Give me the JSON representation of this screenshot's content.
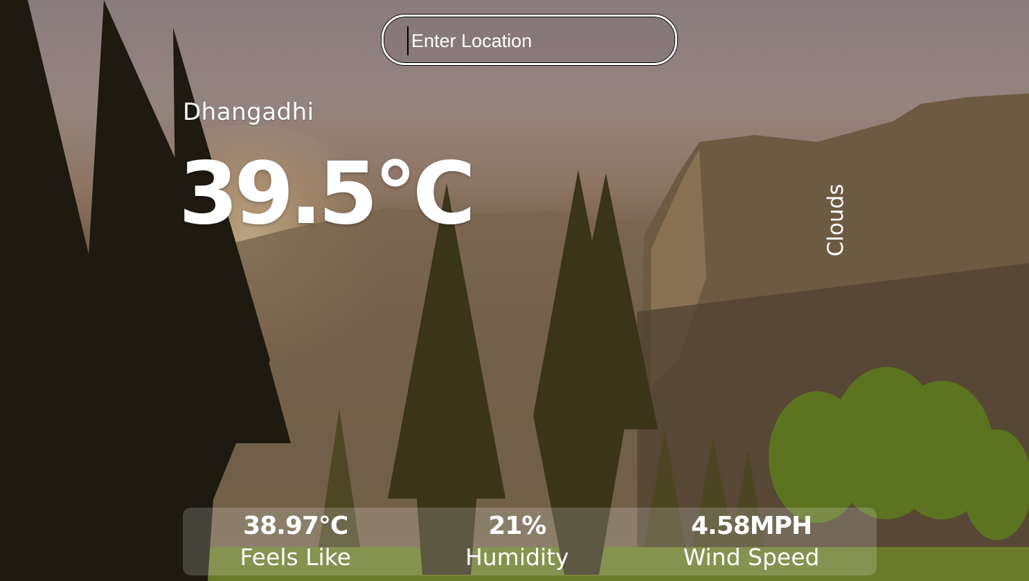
{
  "search": {
    "placeholder": "Enter Location"
  },
  "weather": {
    "location": "Dhangadhi",
    "temperature": "39.5°C",
    "condition": "Clouds"
  },
  "stats": [
    {
      "value": "38.97°C",
      "label": "Feels Like"
    },
    {
      "value": "21%",
      "label": "Humidity"
    },
    {
      "value": "4.58MPH",
      "label": "Wind Speed"
    }
  ],
  "background": {
    "description_icon": "mountain-forest-photo",
    "sky_color": "#8a7c7e",
    "foliage_color": "#4e5a22"
  }
}
